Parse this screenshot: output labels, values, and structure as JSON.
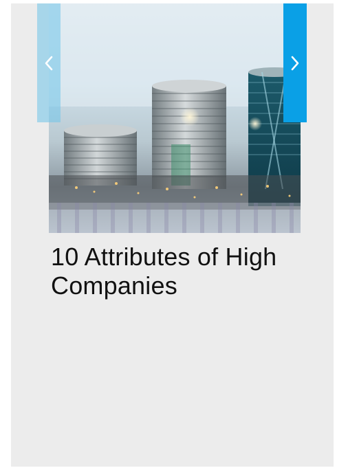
{
  "slide": {
    "title": "10 Attributes of High Companies",
    "image": {
      "icon": "coin-stacks-city-photo"
    }
  },
  "carousel": {
    "prev_icon": "chevron-left-icon",
    "next_icon": "chevron-right-icon",
    "accent_color": "#0aa0e6"
  }
}
